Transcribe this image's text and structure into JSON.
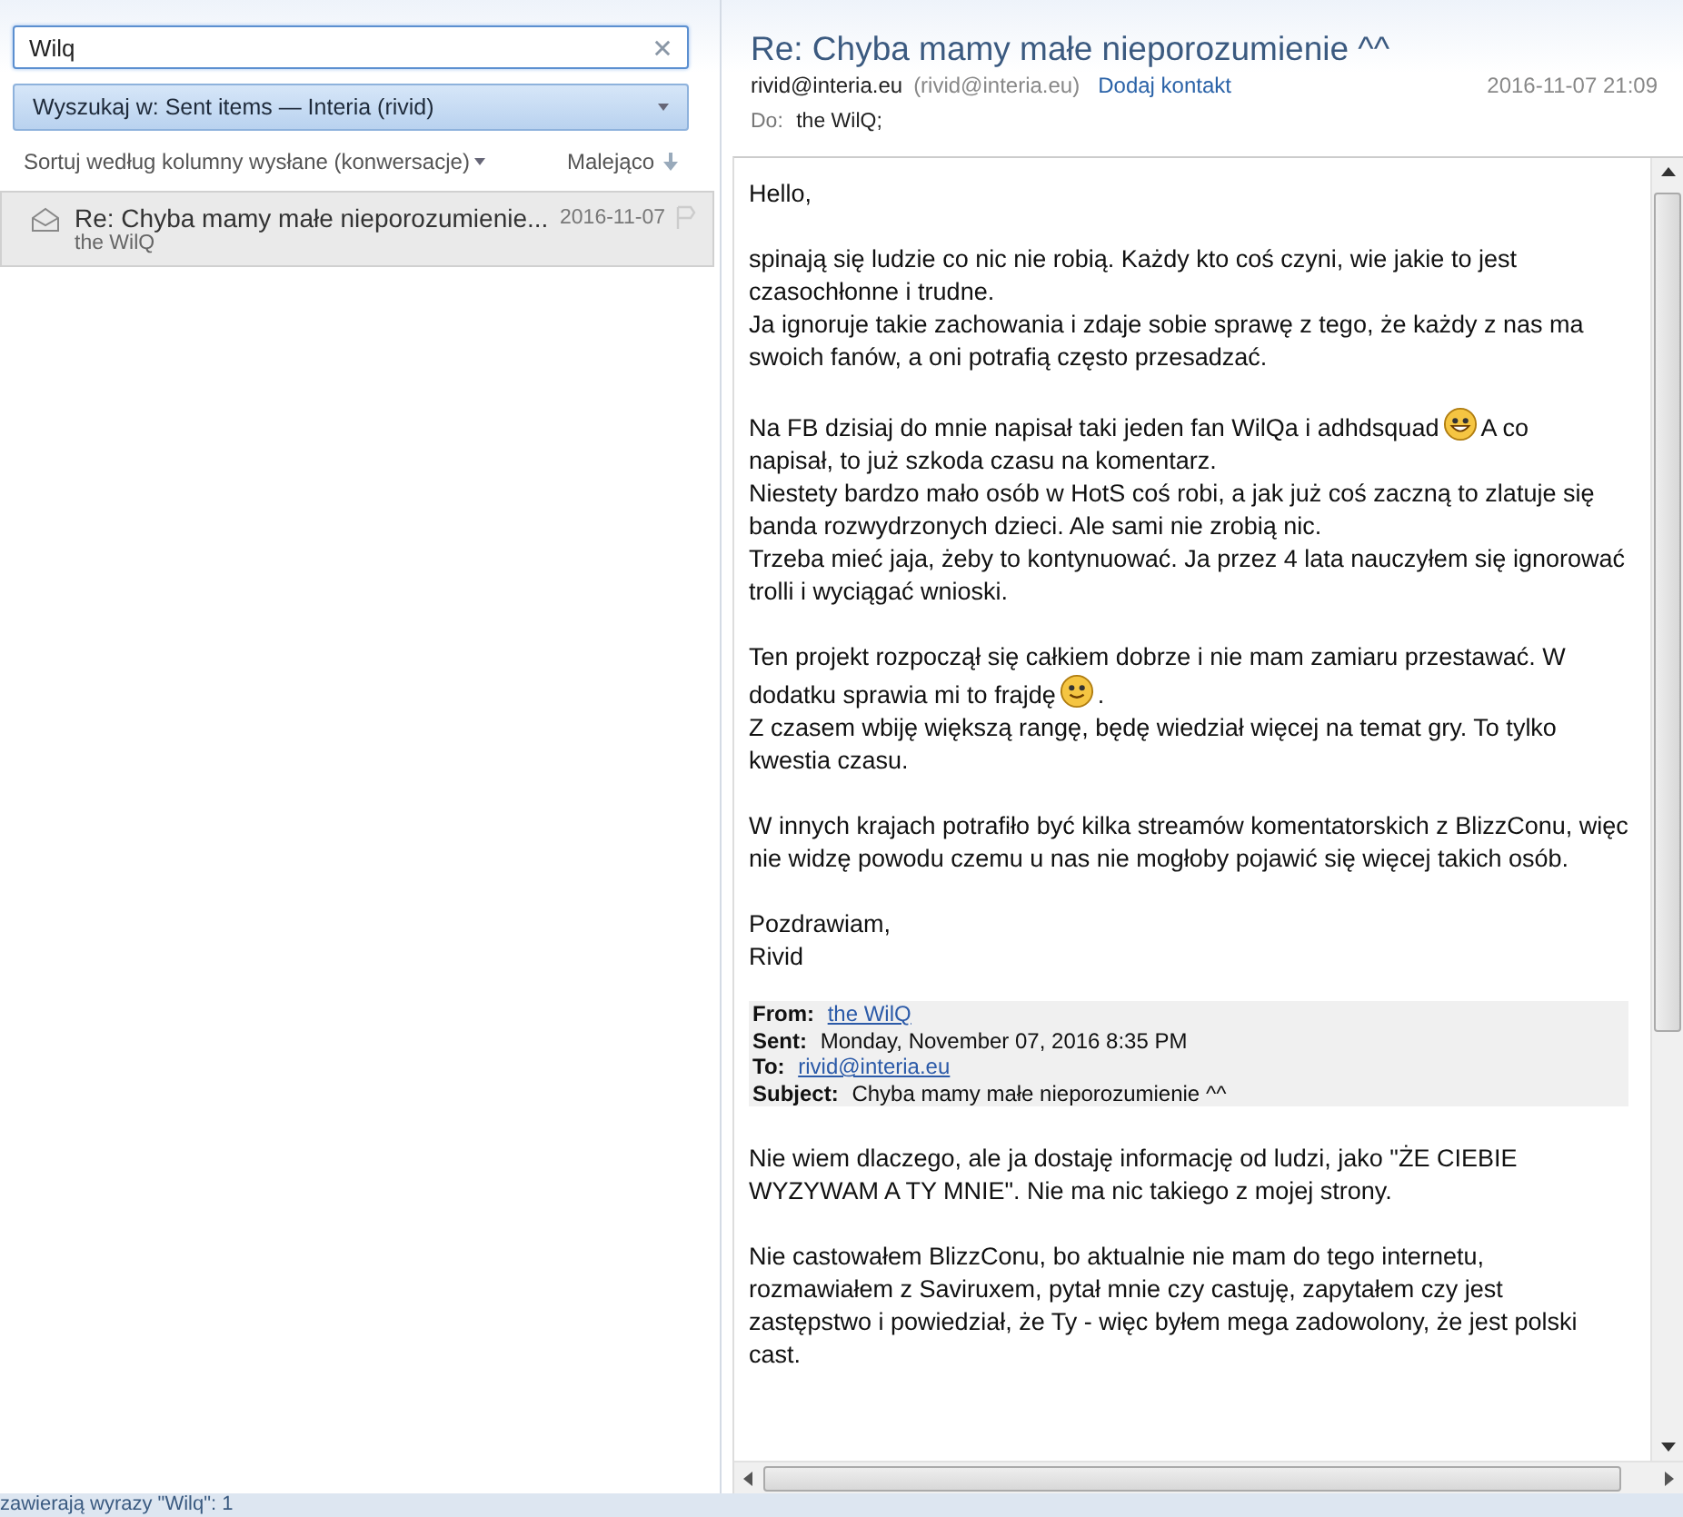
{
  "search": {
    "value": "Wilq"
  },
  "scope_dropdown": {
    "label": "Wyszukaj w: Sent items — Interia (rivid)"
  },
  "sort": {
    "label": "Sortuj według kolumny wysłane (konwersacje)",
    "order": "Malejąco"
  },
  "messages": [
    {
      "subject": "Re: Chyba mamy małe nieporozumienie...",
      "sender": "the WilQ",
      "date": "2016-11-07",
      "selected": true,
      "flagged": false
    }
  ],
  "reading_pane": {
    "subject": "Re: Chyba mamy małe nieporozumienie ^^",
    "from_name": "rivid@interia.eu",
    "from_address": "(rivid@interia.eu)",
    "add_contact": "Dodaj kontakt",
    "date": "2016-11-07 21:09",
    "to_label": "Do:",
    "to": "the WilQ;",
    "body_top": [
      [
        [
          {
            "kind": "text",
            "text": "Hello,"
          }
        ]
      ],
      [
        [
          {
            "kind": "text",
            "text": "spinają się ludzie co nic nie robią. Każdy kto coś czyni, wie jakie to jest czasochłonne i trudne."
          }
        ],
        [
          {
            "kind": "text",
            "text": "Ja ignoruje takie zachowania i zdaje sobie sprawę z tego, że każdy z nas ma swoich fanów, a oni potrafią często przesadzać."
          }
        ]
      ],
      [
        [
          {
            "kind": "text",
            "text": "Na FB dzisiaj do mnie napisał taki jeden fan WilQa i adhdsquad"
          },
          {
            "kind": "grin"
          },
          {
            "kind": "text",
            "text": "A co"
          }
        ],
        [
          {
            "kind": "text",
            "text": "napisał, to już szkoda czasu na komentarz."
          }
        ],
        [
          {
            "kind": "text",
            "text": "Niestety bardzo mało osób w HotS coś robi, a jak już coś zaczną to zlatuje się banda rozwydrzonych dzieci. Ale sami nie zrobią nic."
          }
        ],
        [
          {
            "kind": "text",
            "text": "Trzeba mieć jaja, żeby to kontynuować. Ja przez 4 lata nauczyłem się ignorować trolli i wyciągać wnioski."
          }
        ]
      ],
      [
        [
          {
            "kind": "text",
            "text": "Ten projekt rozpoczął się całkiem dobrze i nie mam zamiaru przestawać. W"
          }
        ],
        [
          {
            "kind": "text",
            "text": "dodatku sprawia mi to frajdę"
          },
          {
            "kind": "smile"
          },
          {
            "kind": "text",
            "text": "."
          }
        ],
        [
          {
            "kind": "text",
            "text": "Z czasem wbiję większą rangę, będę wiedział więcej na temat gry. To tylko kwestia czasu."
          }
        ]
      ],
      [
        [
          {
            "kind": "text",
            "text": "W innych krajach potrafiło być kilka streamów komentatorskich z BlizzConu, więc nie widzę powodu czemu u nas nie mogłoby pojawić się więcej takich osób."
          }
        ]
      ],
      [
        [
          {
            "kind": "text",
            "text": "Pozdrawiam,"
          }
        ],
        [
          {
            "kind": "text",
            "text": "Rivid"
          }
        ]
      ]
    ],
    "quote_header": [
      {
        "label": "From:",
        "value": "the WilQ",
        "kind": "link"
      },
      {
        "label": "Sent:",
        "value": "Monday, November 07, 2016 8:35 PM",
        "kind": "text"
      },
      {
        "label": "To:",
        "value": "rivid@interia.eu",
        "kind": "link"
      },
      {
        "label": "Subject:",
        "value": "Chyba mamy małe nieporozumienie ^^",
        "kind": "text"
      }
    ],
    "body_bottom": [
      [
        [
          {
            "kind": "text",
            "text": "Nie wiem dlaczego, ale ja dostaję informację od ludzi, jako \"ŻE CIEBIE WYZYWAM A TY MNIE\". Nie ma nic takiego z mojej strony."
          }
        ]
      ],
      [
        [
          {
            "kind": "text",
            "text": "Nie castowałem BlizzConu, bo aktualnie nie mam do tego internetu, rozmawiałem z Saviruxem, pytał mnie czy castuję, zapytałem czy jest zastępstwo i powiedział, że Ty - więc byłem mega zadowolony, że jest polski cast."
          }
        ]
      ]
    ]
  },
  "status_bar": "zawierają wyrazy \"Wilq\": 1"
}
